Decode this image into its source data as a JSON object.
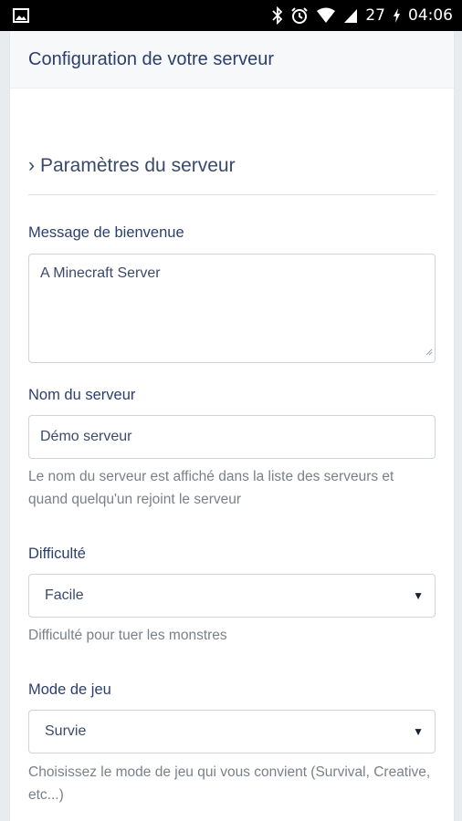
{
  "status_bar": {
    "battery_level": "27",
    "time": "04:06",
    "icons": [
      "image-icon",
      "bluetooth-icon",
      "alarm-icon",
      "wifi-icon",
      "signal-icon",
      "battery-charging-icon"
    ]
  },
  "card": {
    "title": "Configuration de votre serveur"
  },
  "section": {
    "chevron": "›",
    "title": "Paramètres du serveur"
  },
  "welcome": {
    "label": "Message de bienvenue",
    "value": "A Minecraft Server"
  },
  "server_name": {
    "label": "Nom du serveur",
    "value": "Démo serveur",
    "help": "Le nom du serveur est affiché dans la liste des serveurs et quand quelqu'un rejoint le serveur"
  },
  "difficulty": {
    "label": "Difficulté",
    "selected": "Facile",
    "help": "Difficulté pour tuer les monstres"
  },
  "game_mode": {
    "label": "Mode de jeu",
    "selected": "Survie",
    "help": "Choisissez le mode de jeu qui vous convient (Survival, Creative, etc...)"
  },
  "colors": {
    "text_primary": "#2c3e6b",
    "help_text": "#7b8088",
    "border": "#ced4da",
    "header_bg": "#f7f8fa"
  }
}
